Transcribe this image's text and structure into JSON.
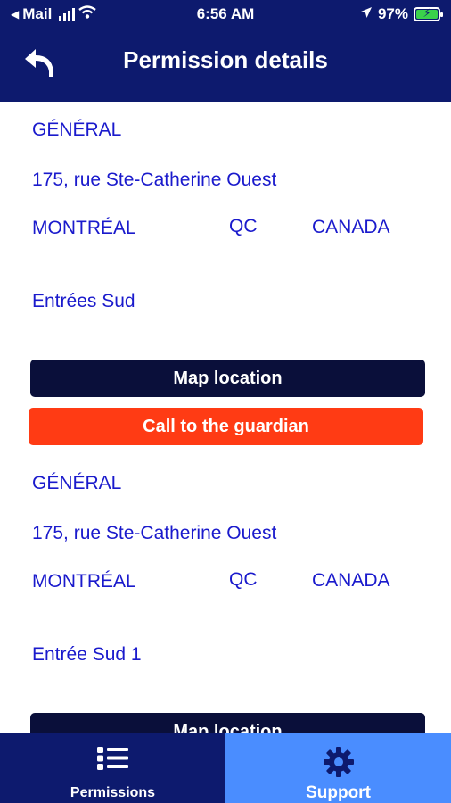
{
  "status_bar": {
    "carrier": "Mail",
    "time": "6:56 AM",
    "battery_percent": "97%",
    "icons": [
      "back-arrow-icon",
      "signal-bars-icon",
      "wifi-icon",
      "location-arrow-icon",
      "battery-charging-icon"
    ]
  },
  "header": {
    "title": "Permission details",
    "back_icon": "undo-arrow-icon"
  },
  "permissions": [
    {
      "category": "GÉNÉRAL",
      "address": "175, rue Ste-Catherine Ouest",
      "city": "MONTRÉAL",
      "province": "QC",
      "country": "CANADA",
      "entrance": "Entrées Sud",
      "map_button": "Map location",
      "call_button": "Call to the guardian"
    },
    {
      "category": "GÉNÉRAL",
      "address": "175, rue Ste-Catherine Ouest",
      "city": "MONTRÉAL",
      "province": "QC",
      "country": "CANADA",
      "entrance": "Entrée Sud 1",
      "map_button": "Map location"
    }
  ],
  "tab_bar": {
    "tabs": [
      {
        "label": "Permissions",
        "icon": "list-icon",
        "active": false
      },
      {
        "label": "Support",
        "icon": "gear-icon",
        "active": true
      }
    ]
  },
  "colors": {
    "nav_background": "#0d1a6e",
    "text_blue": "#1a1acc",
    "map_button": "#0a0f3a",
    "call_button": "#ff3b14",
    "support_tab": "#4a8dff"
  }
}
